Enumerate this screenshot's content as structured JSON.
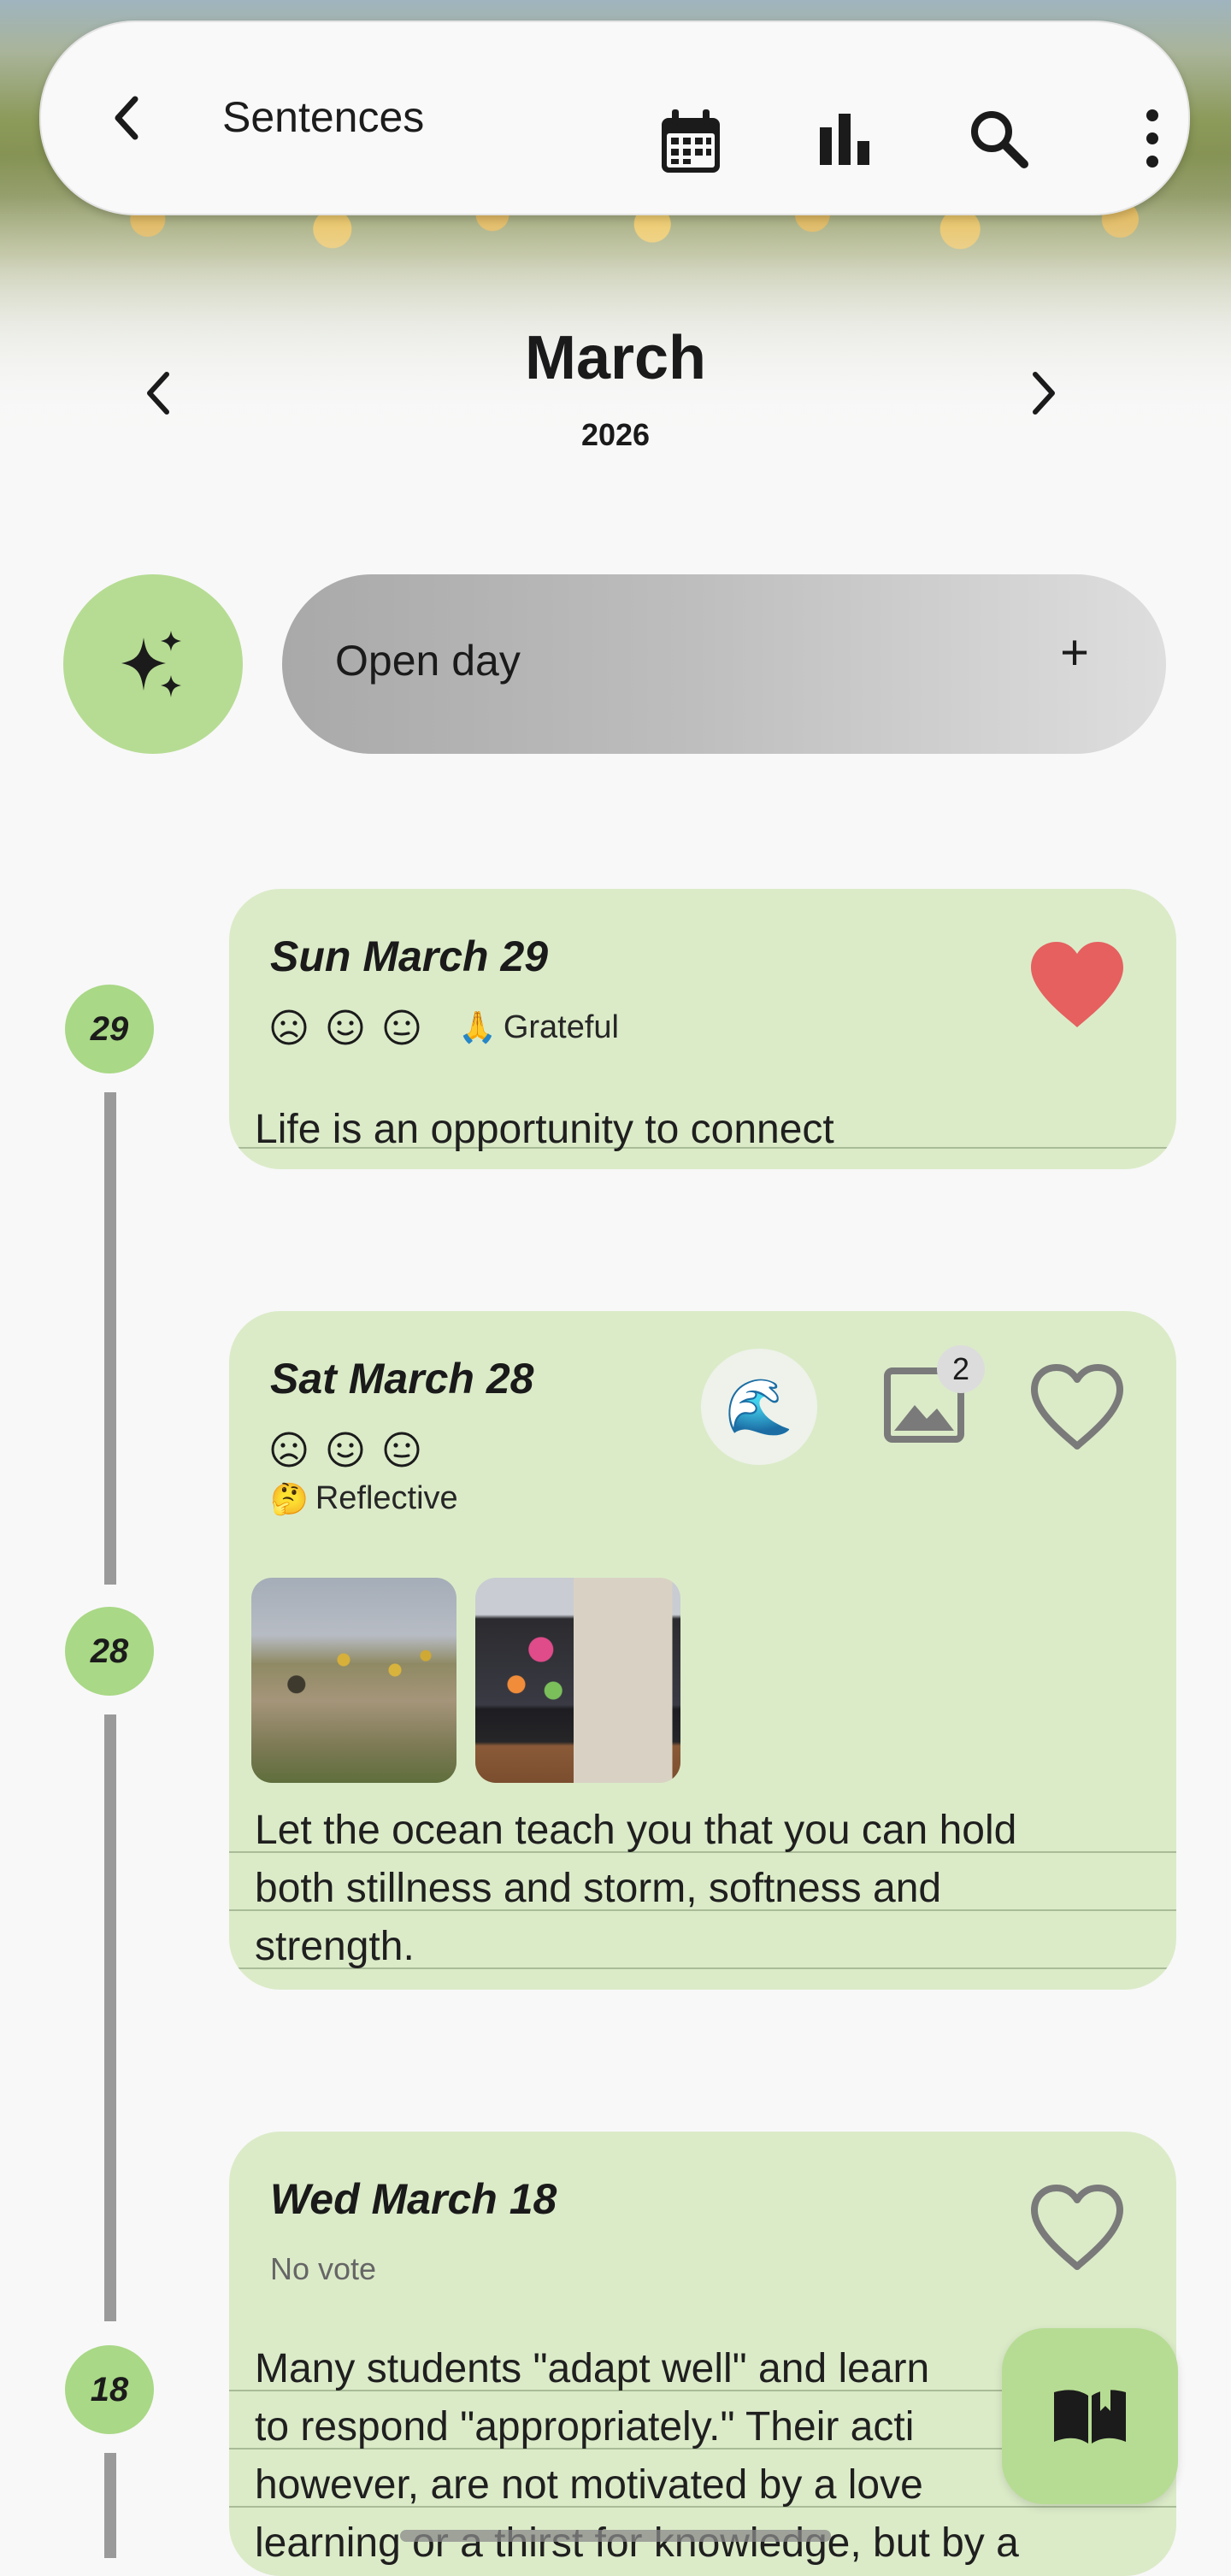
{
  "app_bar": {
    "title": "Sentences",
    "icons": [
      "back-chevron-icon",
      "calendar-icon",
      "bar-chart-icon",
      "search-icon",
      "more-vert-icon"
    ]
  },
  "month_selector": {
    "month": "March",
    "year": "2026"
  },
  "open_day": {
    "label": "Open day",
    "plus": "+"
  },
  "colors": {
    "accent_green": "#b6dc93",
    "card_green": "#dbebc8",
    "dot_green": "#a9d886",
    "heart_red": "#e5605f",
    "heart_outline": "#7a7a7a",
    "timeline_gray": "#9a9a9a"
  },
  "entries": [
    {
      "day": "29",
      "date": "Sun March 29",
      "faces": [
        "sad-face-icon",
        "smile-face-icon",
        "neutral-face-icon"
      ],
      "tag_emoji": "🙏",
      "tag": "Grateful",
      "favorite": true,
      "text": "Life is an opportunity to connect"
    },
    {
      "day": "28",
      "date": "Sat March 28",
      "faces": [
        "sad-face-icon",
        "smile-face-icon",
        "neutral-face-icon"
      ],
      "tag_emoji": "🤔",
      "tag": "Reflective",
      "badge_emoji": "🌊",
      "image_count": "2",
      "favorite": false,
      "text_lines": [
        "Let the ocean teach you that you can hold",
        "both stillness and storm, softness and",
        "strength."
      ]
    },
    {
      "day": "18",
      "date": "Wed March 18",
      "vote": "No vote",
      "favorite": false,
      "text_lines": [
        "Many students \"adapt well\" and learn",
        "to respond \"appropriately.\" Their acti",
        "however, are not motivated by a love",
        "learning or a thirst for knowledge, but by a"
      ]
    }
  ],
  "fab": {
    "icon": "open-book-icon"
  }
}
